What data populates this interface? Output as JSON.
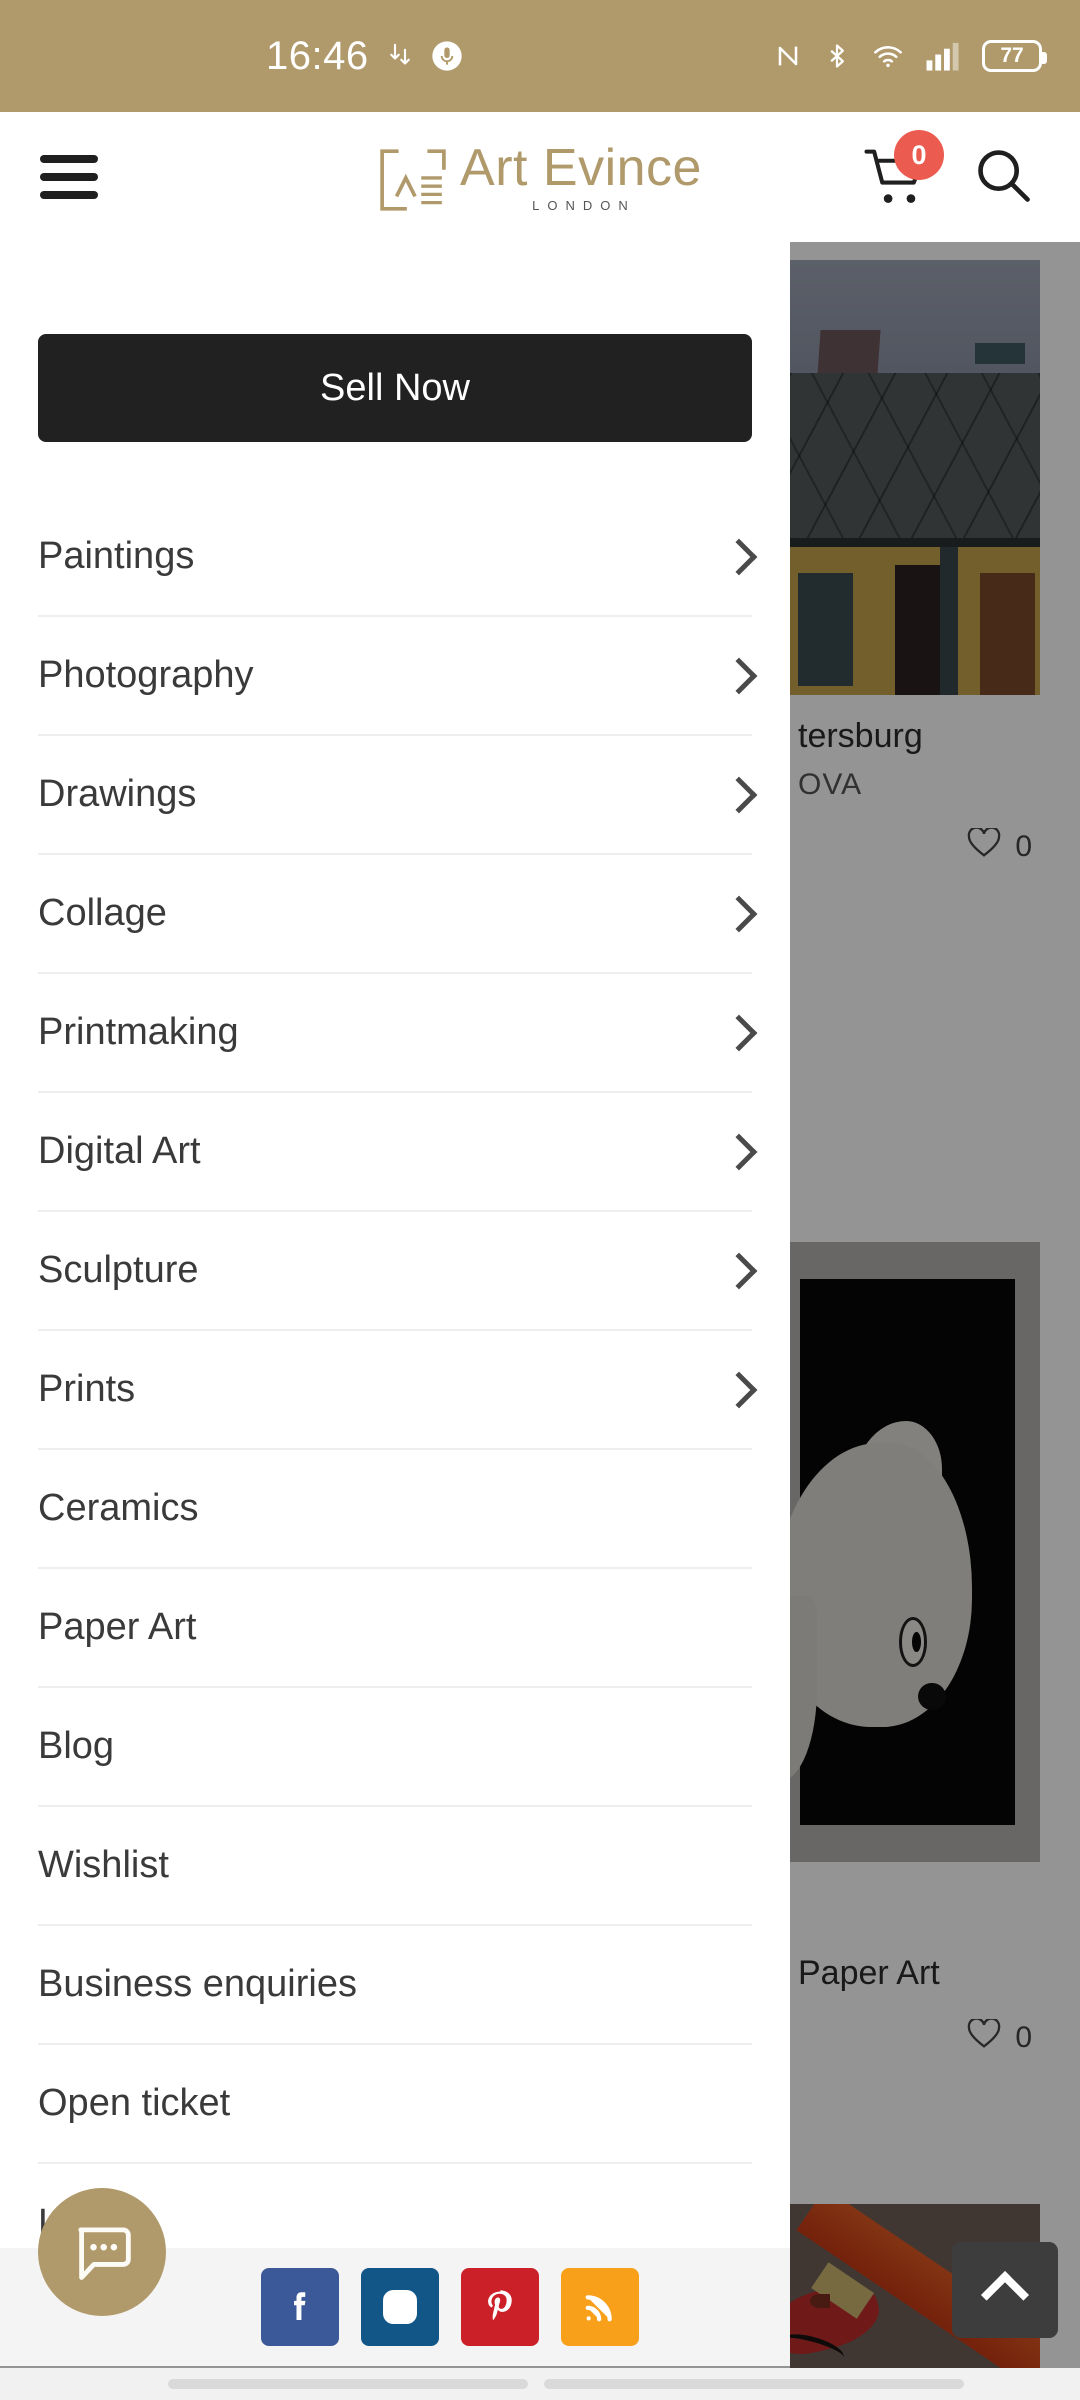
{
  "status_bar": {
    "time": "16:46",
    "left_icons": [
      "download-arrows-icon",
      "microphone-icon"
    ],
    "right_icons": [
      "nfc-icon",
      "bluetooth-icon",
      "wifi-icon",
      "cellular-signal-icon"
    ],
    "battery_percent": "77",
    "background_color": "#b09a6b"
  },
  "header": {
    "menu_icon": "hamburger-menu-icon",
    "logo_name": "Art Evince",
    "logo_sub": "LONDON",
    "logo_color": "#b09a6b",
    "cart_icon": "shopping-cart-icon",
    "cart_count": "0",
    "cart_badge_color": "#ec5b4f",
    "search_icon": "search-icon"
  },
  "drawer": {
    "sell_button": "Sell Now",
    "menu_items": [
      {
        "label": "Paintings",
        "has_chevron": true
      },
      {
        "label": "Photography",
        "has_chevron": true
      },
      {
        "label": "Drawings",
        "has_chevron": true
      },
      {
        "label": "Collage",
        "has_chevron": true
      },
      {
        "label": "Printmaking",
        "has_chevron": true
      },
      {
        "label": "Digital Art",
        "has_chevron": true
      },
      {
        "label": "Sculpture",
        "has_chevron": true
      },
      {
        "label": "Prints",
        "has_chevron": true
      },
      {
        "label": "Ceramics",
        "has_chevron": false
      },
      {
        "label": "Paper Art",
        "has_chevron": false
      },
      {
        "label": "Blog",
        "has_chevron": false
      },
      {
        "label": "Wishlist",
        "has_chevron": false
      },
      {
        "label": "Business enquiries",
        "has_chevron": false
      },
      {
        "label": "Open ticket",
        "has_chevron": false
      },
      {
        "label": "Login",
        "has_chevron": false
      }
    ],
    "social": [
      {
        "name": "facebook-icon",
        "color": "#3b5998"
      },
      {
        "name": "instagram-icon",
        "color": "#125688"
      },
      {
        "name": "pinterest-icon",
        "color": "#cb2027"
      },
      {
        "name": "rss-icon",
        "color": "#f9a01b"
      }
    ],
    "chat_icon": "chat-bubble-icon"
  },
  "background": {
    "cards": [
      {
        "title": "tersburg",
        "artist": "OVA",
        "likes": "0",
        "artwork": "rooftops-painting"
      },
      {
        "title": "Paper Art",
        "artist": "",
        "likes": "0",
        "artwork": "fish-photograph"
      },
      {
        "title": "",
        "artist": "",
        "likes": "",
        "artwork": "colored-pencil-drawing"
      }
    ],
    "like_icon": "heart-icon",
    "scroll_top_icon": "chevron-up-icon"
  }
}
